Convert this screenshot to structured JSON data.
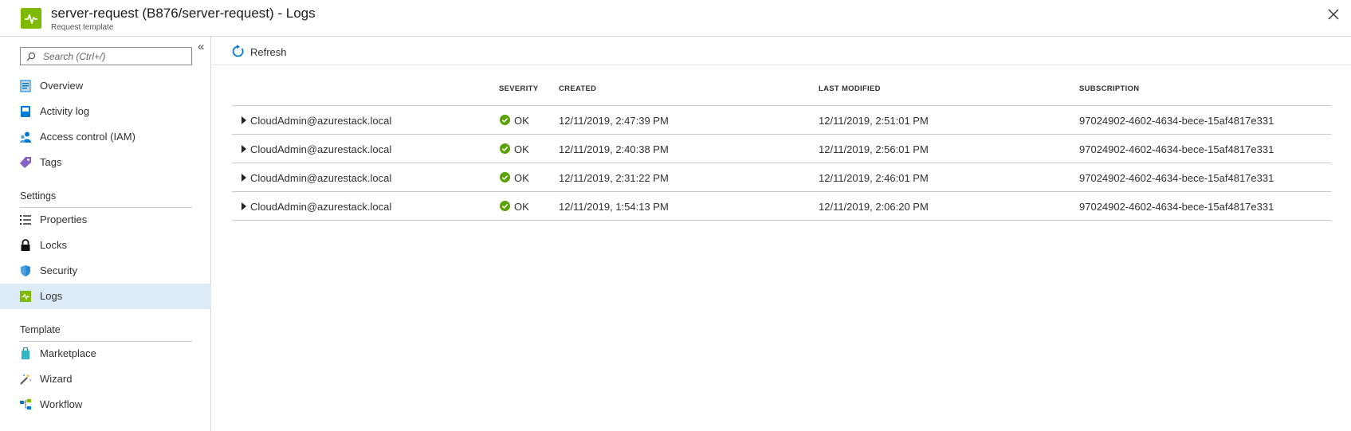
{
  "header": {
    "title": "server-request (B876/server-request) - Logs",
    "subtitle": "Request template",
    "icon": "logs-icon",
    "accent_color": "#7fba00"
  },
  "sidebar": {
    "search_placeholder": "Search (Ctrl+/)",
    "collapse_label": "«",
    "items": [
      {
        "label": "Overview",
        "icon": "overview-icon"
      },
      {
        "label": "Activity log",
        "icon": "activity-log-icon"
      },
      {
        "label": "Access control (IAM)",
        "icon": "iam-icon"
      },
      {
        "label": "Tags",
        "icon": "tag-icon"
      }
    ],
    "settings": {
      "title": "Settings",
      "items": [
        {
          "label": "Properties",
          "icon": "properties-icon"
        },
        {
          "label": "Locks",
          "icon": "lock-icon"
        },
        {
          "label": "Security",
          "icon": "shield-icon"
        },
        {
          "label": "Logs",
          "icon": "logs-icon",
          "active": true
        }
      ]
    },
    "template": {
      "title": "Template",
      "items": [
        {
          "label": "Marketplace",
          "icon": "marketplace-icon"
        },
        {
          "label": "Wizard",
          "icon": "wizard-icon"
        },
        {
          "label": "Workflow",
          "icon": "workflow-icon"
        }
      ]
    },
    "active_color": "#dcebf7"
  },
  "toolbar": {
    "refresh_label": "Refresh"
  },
  "table": {
    "headers": {
      "severity": "SEVERITY",
      "created": "CREATED",
      "last_modified": "LAST MODIFIED",
      "subscription": "SUBSCRIPTION"
    },
    "rows": [
      {
        "user": "CloudAdmin@azurestack.local",
        "severity": "OK",
        "created": "12/11/2019, 2:47:39 PM",
        "last_modified": "12/11/2019, 2:51:01 PM",
        "subscription": "97024902-4602-4634-bece-15af4817e331"
      },
      {
        "user": "CloudAdmin@azurestack.local",
        "severity": "OK",
        "created": "12/11/2019, 2:40:38 PM",
        "last_modified": "12/11/2019, 2:56:01 PM",
        "subscription": "97024902-4602-4634-bece-15af4817e331"
      },
      {
        "user": "CloudAdmin@azurestack.local",
        "severity": "OK",
        "created": "12/11/2019, 2:31:22 PM",
        "last_modified": "12/11/2019, 2:46:01 PM",
        "subscription": "97024902-4602-4634-bece-15af4817e331"
      },
      {
        "user": "CloudAdmin@azurestack.local",
        "severity": "OK",
        "created": "12/11/2019, 1:54:13 PM",
        "last_modified": "12/11/2019, 2:06:20 PM",
        "subscription": "97024902-4602-4634-bece-15af4817e331"
      }
    ],
    "ok_color": "#57a300"
  }
}
